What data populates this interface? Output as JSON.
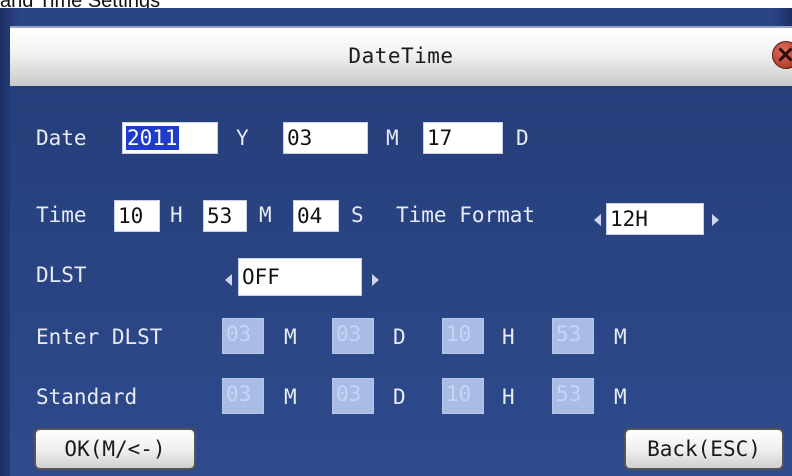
{
  "caption": "and Time Settings",
  "window": {
    "title": "DateTime"
  },
  "date": {
    "label": "Date",
    "year": "2011",
    "year_unit": "Y",
    "month": "03",
    "month_unit": "M",
    "day": "17",
    "day_unit": "D"
  },
  "time": {
    "label": "Time",
    "hour": "10",
    "hour_unit": "H",
    "minute": "53",
    "minute_unit": "M",
    "second": "04",
    "second_unit": "S",
    "format_label": "Time Format",
    "format_value": "12H"
  },
  "dlst": {
    "label": "DLST",
    "value": "OFF"
  },
  "enter_dlst": {
    "label": "Enter DLST",
    "month": "03",
    "month_unit": "M",
    "day": "03",
    "day_unit": "D",
    "hour": "10",
    "hour_unit": "H",
    "minute": "53",
    "minute_unit": "M"
  },
  "standard": {
    "label": "Standard",
    "month": "03",
    "month_unit": "M",
    "day": "03",
    "day_unit": "D",
    "hour": "10",
    "hour_unit": "H",
    "minute": "53",
    "minute_unit": "M"
  },
  "buttons": {
    "ok": "OK(M/<-)",
    "back": "Back(ESC)"
  },
  "colors": {
    "panel": "#2a4584",
    "highlight": "#1e3cc8",
    "disabled_field": "#aabce6"
  }
}
